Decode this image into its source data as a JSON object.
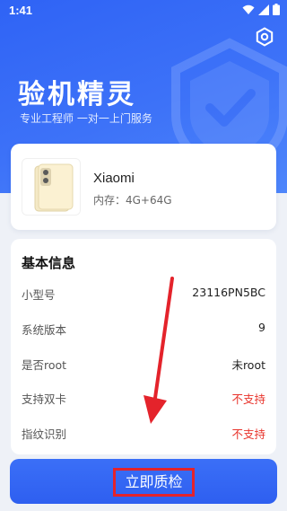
{
  "status_bar": {
    "time": "1:41"
  },
  "header": {
    "title": "验机精灵",
    "subtitle": "专业工程师 一对一上门服务"
  },
  "device": {
    "brand": "Xiaomi",
    "memory": "内存：4G+64G"
  },
  "info": {
    "title": "基本信息",
    "rows": [
      {
        "label": "小型号",
        "value": "23116PN5BC",
        "status": "normal"
      },
      {
        "label": "系统版本",
        "value": "9",
        "status": "normal"
      },
      {
        "label": "是否root",
        "value": "未root",
        "status": "normal"
      },
      {
        "label": "支持双卡",
        "value": "不支持",
        "status": "negative"
      },
      {
        "label": "指纹识别",
        "value": "不支持",
        "status": "negative"
      }
    ]
  },
  "action": {
    "start_label": "立即质检"
  },
  "colors": {
    "primary": "#3366f6",
    "negative": "#e8342c",
    "annotation": "#e4232b"
  }
}
